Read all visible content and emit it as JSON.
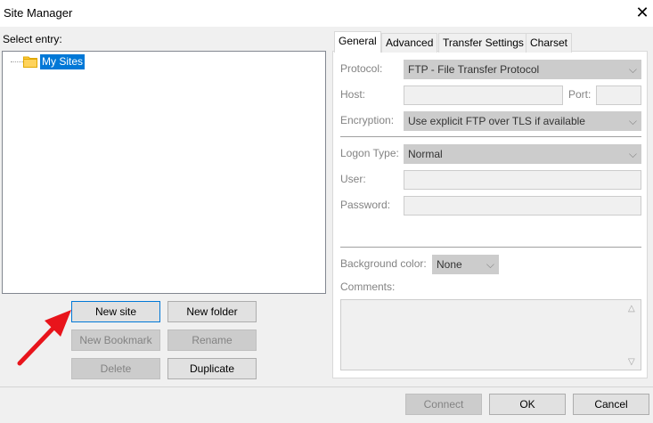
{
  "window": {
    "title": "Site Manager",
    "close_icon": "close-icon"
  },
  "left": {
    "select_entry_label": "Select entry:",
    "tree": {
      "root_label": "My Sites",
      "root_icon": "folder-icon"
    },
    "buttons": {
      "new_site": "New site",
      "new_folder": "New folder",
      "new_bookmark": "New Bookmark",
      "rename": "Rename",
      "delete": "Delete",
      "duplicate": "Duplicate"
    }
  },
  "tabs": [
    {
      "label": "General",
      "active": true
    },
    {
      "label": "Advanced"
    },
    {
      "label": "Transfer Settings"
    },
    {
      "label": "Charset"
    }
  ],
  "general": {
    "protocol_label": "Protocol:",
    "protocol_value": "FTP - File Transfer Protocol",
    "host_label": "Host:",
    "host_value": "",
    "port_label": "Port:",
    "port_value": "",
    "encryption_label": "Encryption:",
    "encryption_value": "Use explicit FTP over TLS if available",
    "logon_type_label": "Logon Type:",
    "logon_type_value": "Normal",
    "user_label": "User:",
    "user_value": "",
    "password_label": "Password:",
    "password_value": "",
    "background_color_label": "Background color:",
    "background_color_value": "None",
    "comments_label": "Comments:",
    "comments_value": ""
  },
  "footer": {
    "connect": "Connect",
    "ok": "OK",
    "cancel": "Cancel"
  },
  "colors": {
    "selection": "#0078d7",
    "arrow_annotation": "#e8141b"
  }
}
